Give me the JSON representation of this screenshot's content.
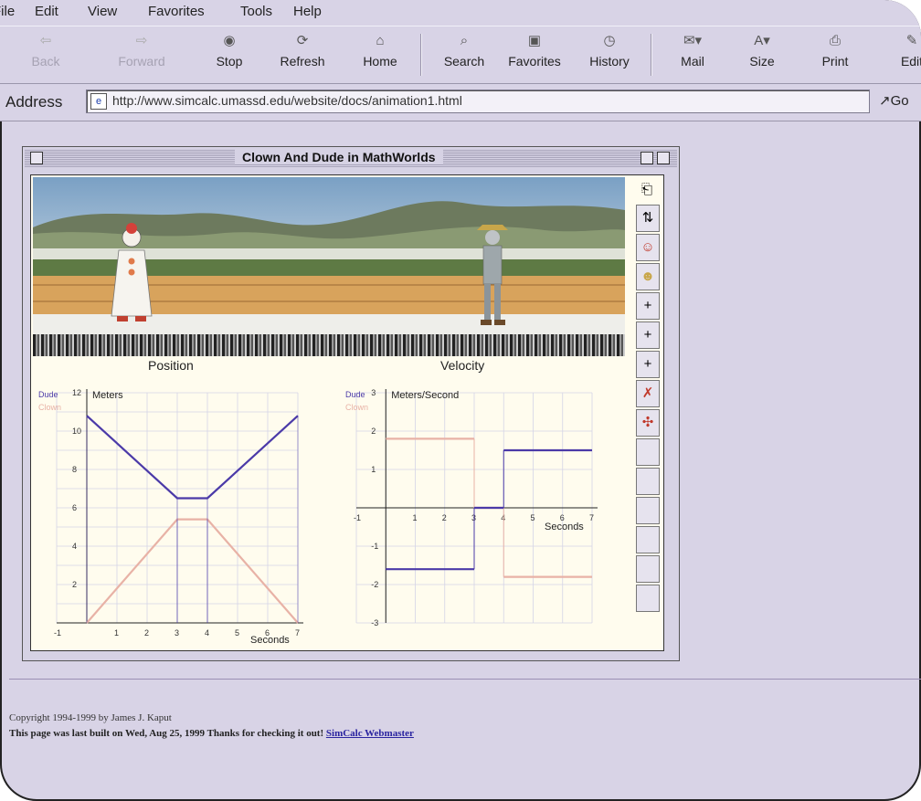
{
  "menu": [
    "File",
    "Edit",
    "View",
    "Favorites",
    "Tools",
    "Help"
  ],
  "toolbar": {
    "back": "Back",
    "forward": "Forward",
    "stop": "Stop",
    "refresh": "Refresh",
    "home": "Home",
    "search": "Search",
    "favorites": "Favorites",
    "history": "History",
    "mail": "Mail",
    "size": "Size",
    "print": "Print",
    "edit": "Edit"
  },
  "address": {
    "label": "Address",
    "url": "http://www.simcalc.umassd.edu/website/docs/animation1.html",
    "go": "Go"
  },
  "applet": {
    "title": "Clown And Dude in MathWorlds",
    "position_title": "Position",
    "velocity_title": "Velocity"
  },
  "chart_data": [
    {
      "type": "line",
      "title": "Position",
      "ylabel": "Meters",
      "xlabel": "Seconds",
      "xlim": [
        -1,
        7
      ],
      "ylim": [
        0,
        12
      ],
      "series": [
        {
          "name": "Dude",
          "color": "#4b3aa8",
          "x": [
            0,
            3,
            4,
            7
          ],
          "y": [
            10.8,
            6.5,
            6.5,
            10.8
          ]
        },
        {
          "name": "Clown",
          "color": "#e8b2a6",
          "x": [
            0,
            3,
            4,
            7
          ],
          "y": [
            0,
            5.4,
            5.4,
            0
          ]
        }
      ]
    },
    {
      "type": "line",
      "title": "Velocity",
      "ylabel": "Meters/Second",
      "xlabel": "Seconds",
      "xlim": [
        -1,
        7
      ],
      "ylim": [
        -3,
        3
      ],
      "series": [
        {
          "name": "Dude",
          "color": "#4b3aa8",
          "segments": [
            [
              0,
              3,
              -1.6
            ],
            [
              3,
              4,
              0
            ],
            [
              4,
              7,
              1.5
            ]
          ]
        },
        {
          "name": "Clown",
          "color": "#e8b2a6",
          "segments": [
            [
              0,
              3,
              1.8
            ],
            [
              3,
              4,
              0
            ],
            [
              4,
              7,
              -1.8
            ]
          ]
        }
      ]
    }
  ],
  "footer": {
    "copyright": "Copyright 1994-1999 by James J. Kaput",
    "built": "This page was last built on Wed, Aug 25, 1999 Thanks for checking it out!",
    "link": "SimCalc Webmaster"
  }
}
